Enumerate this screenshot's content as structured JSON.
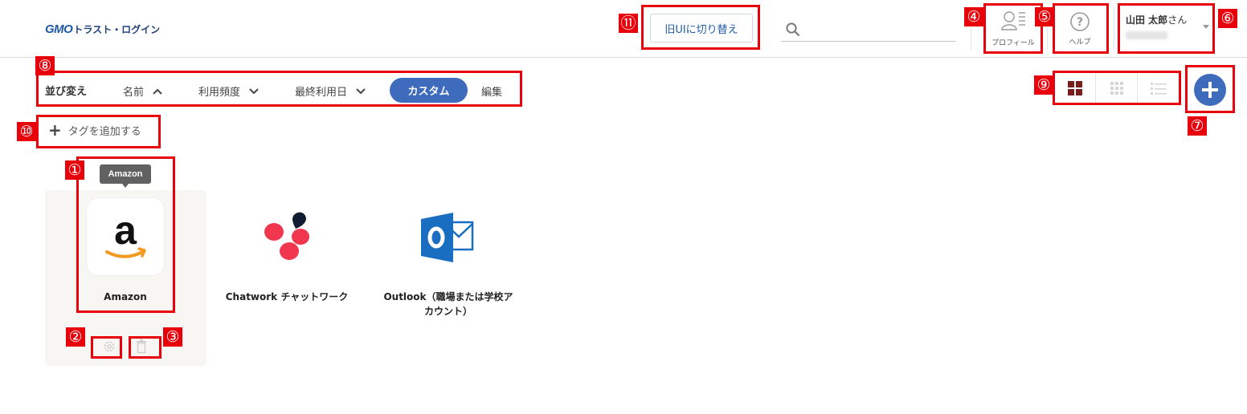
{
  "header": {
    "logo_primary": "GMO",
    "logo_secondary": "トラスト・ログイン",
    "old_ui_button": "旧UIに切り替え",
    "search_placeholder": "",
    "profile_label": "プロフィール",
    "help_label": "ヘルプ",
    "user_name": "山田 太郎",
    "user_suffix": "さん"
  },
  "sort": {
    "label": "並び変え",
    "items": [
      {
        "label": "名前",
        "direction": "up"
      },
      {
        "label": "利用頻度",
        "direction": "down"
      },
      {
        "label": "最終利用日",
        "direction": "down"
      }
    ],
    "active": "カスタム",
    "edit": "編集"
  },
  "tags": {
    "add_label": "タグを追加する"
  },
  "apps": [
    {
      "name": "Amazon",
      "tooltip": "Amazon",
      "icon": "amazon-logo-icon"
    },
    {
      "name": "Chatwork チャットワーク",
      "icon": "chatwork-logo-icon"
    },
    {
      "name_line1": "Outlook（職場または学校ア",
      "name_line2": "カウント）",
      "icon": "outlook-logo-icon"
    }
  ],
  "markers": [
    "①",
    "②",
    "③",
    "④",
    "⑤",
    "⑥",
    "⑦",
    "⑧",
    "⑨",
    "⑩",
    "⑪"
  ],
  "colors": {
    "accent": "#3f6bbd",
    "annotation": "#e8000b",
    "grid_active": "#7a1c1c"
  }
}
